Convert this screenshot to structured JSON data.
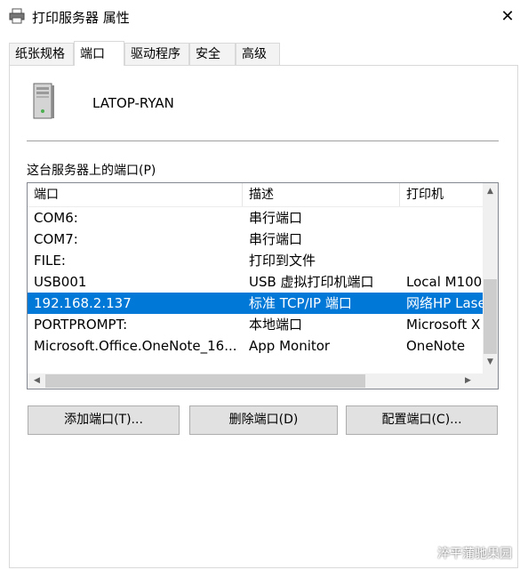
{
  "window": {
    "title": "打印服务器 属性",
    "close_glyph": "✕"
  },
  "tabs": [
    {
      "label": "纸张规格",
      "active": false
    },
    {
      "label": "端口",
      "active": true
    },
    {
      "label": "驱动程序",
      "active": false
    },
    {
      "label": "安全",
      "active": false
    },
    {
      "label": "高级",
      "active": false
    }
  ],
  "server": {
    "name": "LATOP-RYAN",
    "icon": "server-tower-icon"
  },
  "ports_section": {
    "label": "这台服务器上的端口(P)",
    "columns": [
      "端口",
      "描述",
      "打印机"
    ],
    "rows": [
      {
        "port": "COM6:",
        "description": "串行端口",
        "printer": "",
        "selected": false
      },
      {
        "port": "COM7:",
        "description": "串行端口",
        "printer": "",
        "selected": false
      },
      {
        "port": "FILE:",
        "description": "打印到文件",
        "printer": "",
        "selected": false
      },
      {
        "port": "USB001",
        "description": "USB 虚拟打印机端口",
        "printer": "Local  M100",
        "selected": false
      },
      {
        "port": "192.168.2.137",
        "description": "标准 TCP/IP 端口",
        "printer": "网络HP Lase",
        "selected": true
      },
      {
        "port": "PORTPROMPT:",
        "description": "本地端口",
        "printer": "Microsoft X",
        "selected": false
      },
      {
        "port": "Microsoft.Office.OneNote_16...",
        "description": "App Monitor",
        "printer": "OneNote",
        "selected": false
      }
    ]
  },
  "buttons": {
    "add": "添加端口(T)...",
    "delete": "删除端口(D)",
    "configure": "配置端口(C)..."
  },
  "watermark": {
    "text": "淬平蒲驰果园",
    "icon": "wechat-icon"
  },
  "colors": {
    "selection": "#0078d7",
    "button_face": "#e1e1e1"
  }
}
